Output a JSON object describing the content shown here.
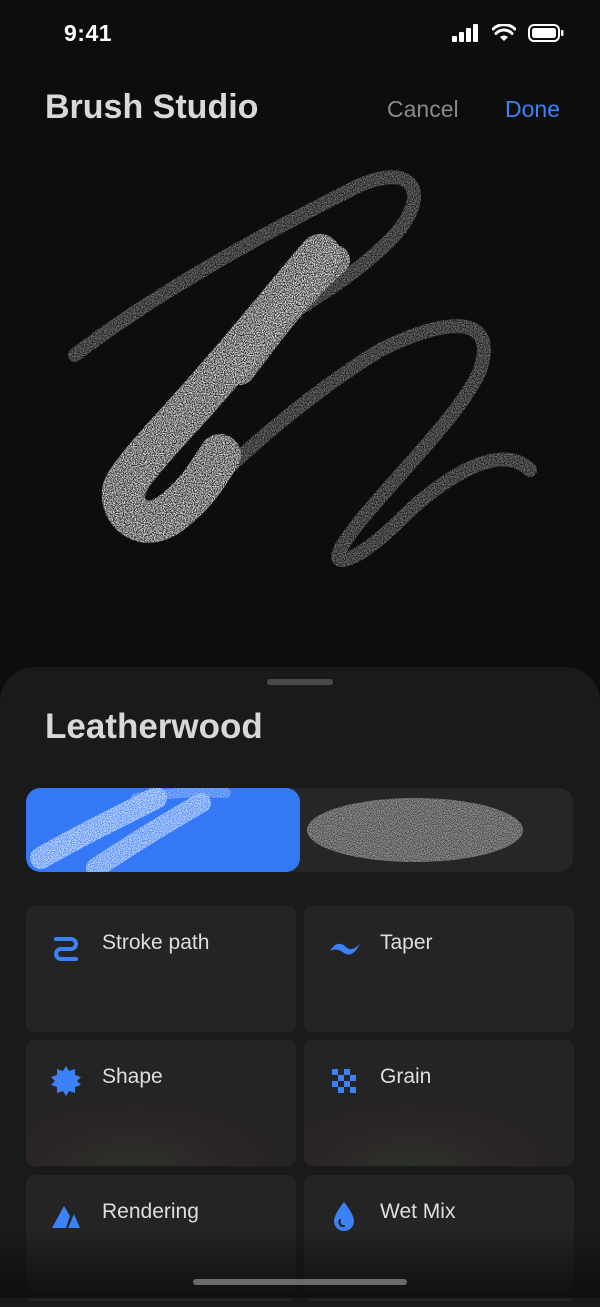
{
  "status_bar": {
    "time": "9:41"
  },
  "header": {
    "title": "Brush Studio",
    "cancel_label": "Cancel",
    "done_label": "Done"
  },
  "sheet": {
    "brush_name": "Leatherwood",
    "tabs": [
      {
        "name": "brush-preview-a",
        "selected": true
      },
      {
        "name": "brush-preview-b",
        "selected": false
      }
    ],
    "tiles": [
      {
        "label": "Stroke path",
        "icon": "stroke-path-icon"
      },
      {
        "label": "Taper",
        "icon": "taper-icon"
      },
      {
        "label": "Shape",
        "icon": "shape-icon"
      },
      {
        "label": "Grain",
        "icon": "grain-icon"
      },
      {
        "label": "Rendering",
        "icon": "rendering-icon"
      },
      {
        "label": "Wet Mix",
        "icon": "wet-mix-icon"
      }
    ]
  },
  "colors": {
    "accent": "#3478f6",
    "background": "#0d0d0d",
    "sheet": "#1a1a1a",
    "tile": "#242424"
  }
}
